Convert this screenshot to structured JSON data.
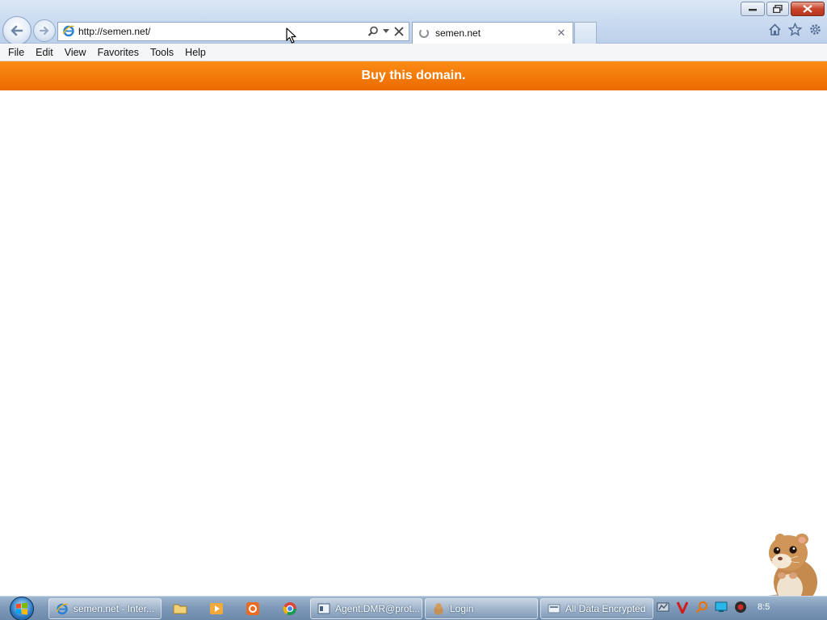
{
  "browser": {
    "address_url": "http://semen.net/",
    "tab_title": "semen.net",
    "menu": [
      "File",
      "Edit",
      "View",
      "Favorites",
      "Tools",
      "Help"
    ]
  },
  "page": {
    "banner_text": "Buy this domain.",
    "banner_color": "#f57c0a"
  },
  "taskbar": {
    "buttons": [
      {
        "label": "semen.net - Inter...",
        "icon": "ie-icon"
      },
      {
        "label": "Agent.DMR@prot...",
        "icon": "agent-icon"
      },
      {
        "label": "Login",
        "icon": "login-icon"
      },
      {
        "label": "All Data Encrypted",
        "icon": "encrypted-icon"
      }
    ],
    "pinned": [
      "explorer-icon",
      "media-player-icon",
      "app-icon",
      "chrome-icon"
    ],
    "tray": [
      "network-icon",
      "v-icon",
      "search-icon",
      "monitor-icon",
      "record-icon"
    ],
    "clock": "8:5"
  }
}
